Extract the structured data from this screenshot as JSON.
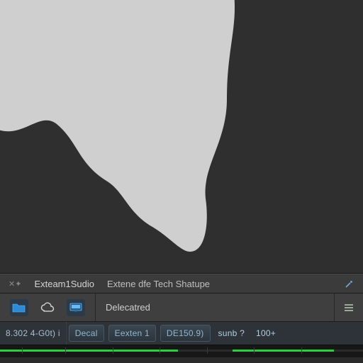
{
  "tabs": {
    "left_glyph": "✕✦",
    "tab1": "Exteam1Sudio",
    "tab2": "Extene dfe Tech Shatupe"
  },
  "toolbar": {
    "mode_label": "Delecatred"
  },
  "status": {
    "readings": "8.302  4-G0t)  i",
    "btn_decal": "Decal",
    "btn_extent": "Eexten 1",
    "btn_de150": "DE150.9)",
    "scrub": "sunb ?",
    "zoom": "100+"
  }
}
